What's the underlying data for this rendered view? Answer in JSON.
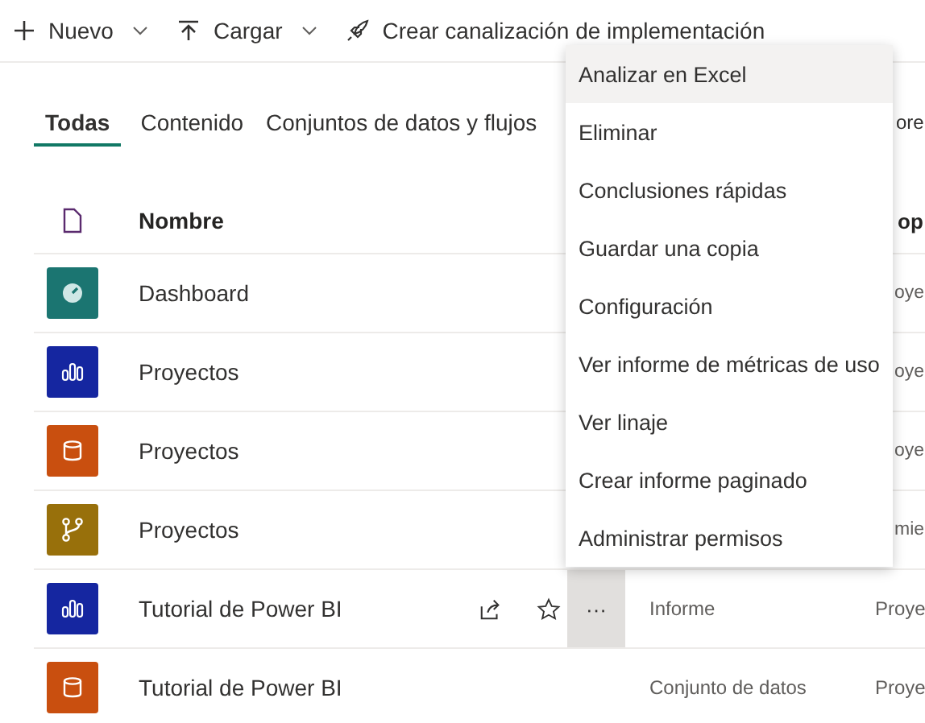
{
  "toolbar": [
    {
      "kind": "add",
      "label": "Nuevo",
      "dropdown": true
    },
    {
      "kind": "upload",
      "label": "Cargar",
      "dropdown": true
    },
    {
      "kind": "rocket",
      "label": "Crear canalización de implementación",
      "dropdown": false
    }
  ],
  "tabs": [
    {
      "label": "Todas",
      "selected": true
    },
    {
      "label": "Contenido",
      "selected": false
    },
    {
      "label": "Conjuntos de datos y flujos",
      "selected": false
    },
    {
      "label": "ore",
      "selected": false
    }
  ],
  "table": {
    "columns": [
      "Nombre",
      "op"
    ],
    "rows": [
      {
        "kind": "dashboard",
        "color": "#1b7571",
        "name": "Dashboard",
        "owner": "oye"
      },
      {
        "kind": "report",
        "color": "#1526a0",
        "name": "Proyectos",
        "owner": "oye"
      },
      {
        "kind": "dataset",
        "color": "#c94f0f",
        "name": "Proyectos",
        "owner": "oye"
      },
      {
        "kind": "dataflow",
        "color": "#98700b",
        "name": "Proyectos",
        "owner": "mie"
      },
      {
        "kind": "report",
        "color": "#1526a0",
        "name": "Tutorial de Power BI",
        "more": "···",
        "type": "Informe",
        "owner": "Proye"
      },
      {
        "kind": "dataset",
        "color": "#c94f0f",
        "name": "Tutorial de Power BI",
        "type": "Conjunto de datos",
        "owner": "Proye"
      }
    ]
  },
  "menu": {
    "items": [
      {
        "label": "Analizar en Excel",
        "highlighted": true
      },
      {
        "label": "Eliminar",
        "highlighted": false
      },
      {
        "label": "Conclusiones rápidas",
        "highlighted": false
      },
      {
        "label": "Guardar una copia",
        "highlighted": false
      },
      {
        "label": "Configuración",
        "highlighted": false
      },
      {
        "label": "Ver informe de métricas de uso",
        "highlighted": false
      },
      {
        "label": "Ver linaje",
        "highlighted": false
      },
      {
        "label": "Crear informe paginado",
        "highlighted": false
      },
      {
        "label": "Administrar permisos",
        "highlighted": false
      }
    ]
  }
}
